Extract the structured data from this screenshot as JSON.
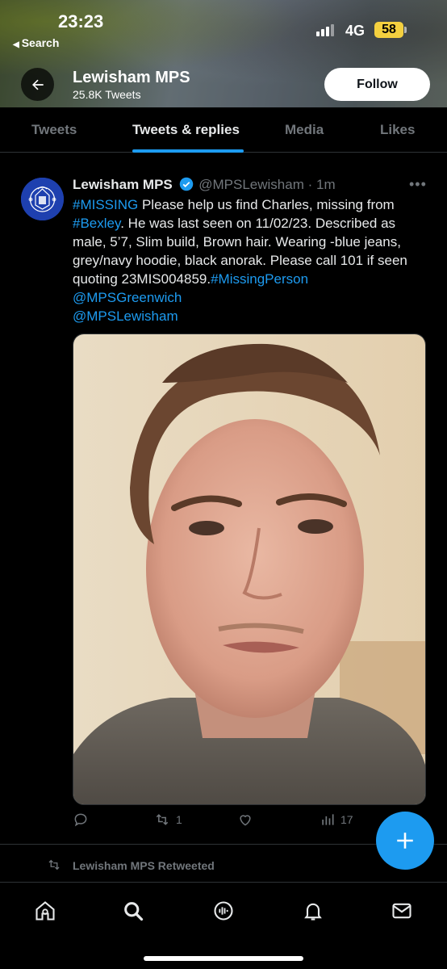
{
  "status_bar": {
    "time": "23:23",
    "back_app_label": "Search",
    "network": "4G",
    "battery": "58"
  },
  "profile": {
    "name": "Lewisham MPS",
    "tweet_count": "25.8K Tweets",
    "follow_label": "Follow"
  },
  "tabs": [
    {
      "label": "Tweets"
    },
    {
      "label": "Tweets & replies"
    },
    {
      "label": "Media"
    },
    {
      "label": "Likes"
    }
  ],
  "tweet": {
    "author_name": "Lewisham MPS",
    "author_handle": "@MPSLewisham",
    "time_ago": "· 1m",
    "text": {
      "hashtag_missing": "#MISSING",
      "part1": " Please help us find Charles, missing from ",
      "hashtag_bexley": "#Bexley",
      "part2": ". He was last seen on 11/02/23. Described as male, 5’7, Slim build, Brown hair. Wearing -blue jeans, grey/navy hoodie, black anorak. Please call 101 if seen quoting 23MIS004859.",
      "hashtag_missingperson": "#MissingPerson",
      "mention_greenwich": "@MPSGreenwich",
      "mention_lewisham": "@MPSLewisham"
    },
    "retweets": "1",
    "views": "17"
  },
  "retweet_row": {
    "label": "Lewisham MPS Retweeted"
  },
  "colors": {
    "accent": "#1d9bf0",
    "muted": "#71767b",
    "background": "#000000"
  },
  "icons": {
    "bottom_nav": [
      "home-icon",
      "search-icon",
      "spaces-icon",
      "notifications-icon",
      "messages-icon"
    ]
  }
}
